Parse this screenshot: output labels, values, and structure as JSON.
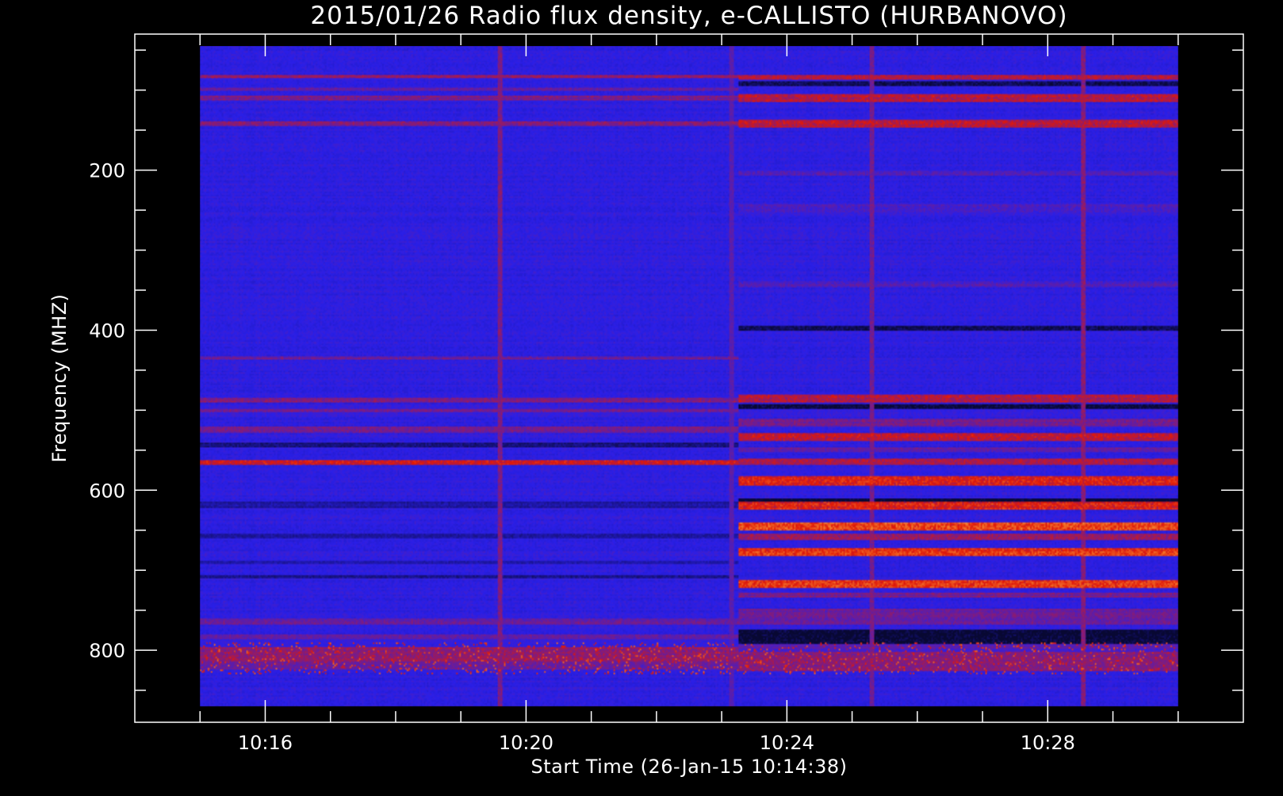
{
  "chart_data": {
    "type": "heatmap",
    "title": "2015/01/26  Radio flux density, e-CALLISTO (HURBANOVO)",
    "xlabel": "Start Time (26-Jan-15 10:14:38)",
    "ylabel": "Frequency (MHZ)",
    "x_start": "10:14:38",
    "x_range_minutes": [
      15.0,
      30.0
    ],
    "x_axis_range_minutes": [
      14.0,
      31.0
    ],
    "x_ticks": [
      {
        "value": 16,
        "label": "10:16"
      },
      {
        "value": 20,
        "label": "10:20"
      },
      {
        "value": 24,
        "label": "10:24"
      },
      {
        "value": 28,
        "label": "10:28"
      }
    ],
    "y_range": [
      45,
      870
    ],
    "y_axis_range": [
      30,
      890
    ],
    "y_inverted": true,
    "y_ticks": [
      {
        "value": 200,
        "label": "200"
      },
      {
        "value": 400,
        "label": "400"
      },
      {
        "value": 600,
        "label": "600"
      },
      {
        "value": 800,
        "label": "800"
      }
    ],
    "onset_minute": 23.25,
    "colors": {
      "background": "#000000",
      "axis": "#ffffff",
      "base": "#2a1fe8",
      "dark": "#0a0a35",
      "red": "#e01808",
      "bright": "#ffb040"
    },
    "bands_before": [
      {
        "from": 80,
        "to": 84,
        "intensity": 0.55
      },
      {
        "from": 96,
        "to": 100,
        "intensity": 0.35
      },
      {
        "from": 106,
        "to": 112,
        "intensity": 0.45
      },
      {
        "from": 138,
        "to": 144,
        "intensity": 0.5
      },
      {
        "from": 432,
        "to": 436,
        "intensity": 0.35
      },
      {
        "from": 484,
        "to": 490,
        "intensity": 0.5
      },
      {
        "from": 498,
        "to": 503,
        "intensity": 0.35
      },
      {
        "from": 520,
        "to": 528,
        "intensity": 0.4
      },
      {
        "from": 540,
        "to": 546,
        "intensity": -0.6
      },
      {
        "from": 562,
        "to": 568,
        "intensity": 0.9
      },
      {
        "from": 615,
        "to": 622,
        "intensity": -0.4
      },
      {
        "from": 655,
        "to": 660,
        "intensity": -0.4
      },
      {
        "from": 688,
        "to": 692,
        "intensity": -0.3
      },
      {
        "from": 706,
        "to": 710,
        "intensity": -0.5
      },
      {
        "from": 760,
        "to": 768,
        "intensity": 0.35
      },
      {
        "from": 780,
        "to": 786,
        "intensity": 0.3
      },
      {
        "from": 796,
        "to": 815,
        "intensity": 0.55
      },
      {
        "from": 815,
        "to": 825,
        "intensity": 0.35
      }
    ],
    "bands_after": [
      {
        "from": 80,
        "to": 86,
        "intensity": 0.7
      },
      {
        "from": 88,
        "to": 94,
        "intensity": -0.8
      },
      {
        "from": 104,
        "to": 114,
        "intensity": 0.75
      },
      {
        "from": 136,
        "to": 146,
        "intensity": 0.8
      },
      {
        "from": 200,
        "to": 206,
        "intensity": 0.2
      },
      {
        "from": 242,
        "to": 252,
        "intensity": 0.2
      },
      {
        "from": 338,
        "to": 346,
        "intensity": 0.2
      },
      {
        "from": 394,
        "to": 400,
        "intensity": -0.8
      },
      {
        "from": 480,
        "to": 490,
        "intensity": 0.75
      },
      {
        "from": 492,
        "to": 498,
        "intensity": -1.0
      },
      {
        "from": 510,
        "to": 520,
        "intensity": 0.4
      },
      {
        "from": 528,
        "to": 538,
        "intensity": 0.8
      },
      {
        "from": 546,
        "to": 552,
        "intensity": 0.3
      },
      {
        "from": 560,
        "to": 568,
        "intensity": 0.7
      },
      {
        "from": 582,
        "to": 594,
        "intensity": 1.0
      },
      {
        "from": 610,
        "to": 615,
        "intensity": -1.0
      },
      {
        "from": 615,
        "to": 625,
        "intensity": 1.0
      },
      {
        "from": 640,
        "to": 650,
        "intensity": 1.3
      },
      {
        "from": 655,
        "to": 662,
        "intensity": 0.6
      },
      {
        "from": 672,
        "to": 682,
        "intensity": 1.15
      },
      {
        "from": 712,
        "to": 722,
        "intensity": 1.2
      },
      {
        "from": 728,
        "to": 734,
        "intensity": 0.4
      },
      {
        "from": 748,
        "to": 768,
        "intensity": 0.35
      },
      {
        "from": 774,
        "to": 792,
        "intensity": -1.0
      },
      {
        "from": 792,
        "to": 802,
        "intensity": 0.2
      },
      {
        "from": 802,
        "to": 826,
        "intensity": 0.5
      }
    ],
    "vertical_lines_minutes": [
      {
        "minute": 19.6,
        "intensity": 0.5
      },
      {
        "minute": 23.15,
        "intensity": 0.3
      },
      {
        "minute": 25.3,
        "intensity": 0.45
      },
      {
        "minute": 28.55,
        "intensity": 0.55
      }
    ]
  }
}
